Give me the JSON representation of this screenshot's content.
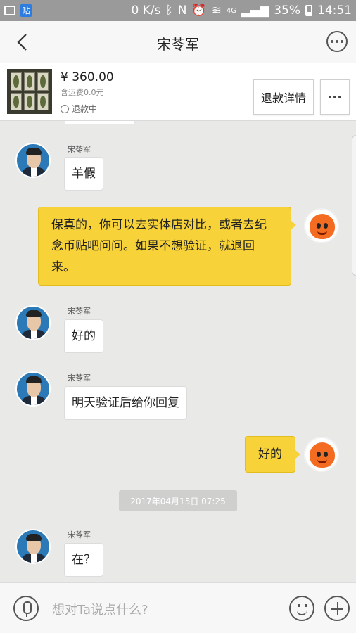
{
  "status_bar": {
    "speed": "0 K/s",
    "network": "4G",
    "battery": "35%",
    "time": "14:51",
    "app_icon": "贴"
  },
  "nav": {
    "title": "宋苓军"
  },
  "product": {
    "price": "¥ 360.00",
    "shipping": "含运费0.0元",
    "status": "退款中",
    "refund_button": "退款详情"
  },
  "messages": [
    {
      "side": "left",
      "name": "宋苓军",
      "text": "羊假"
    },
    {
      "side": "right",
      "text": "保真的，你可以去实体店对比，或者去纪念币贴吧问问。如果不想验证，就退回来。"
    },
    {
      "side": "left",
      "name": "宋苓军",
      "text": "好的"
    },
    {
      "side": "left",
      "name": "宋苓军",
      "text": "明天验证后给你回复"
    },
    {
      "side": "right",
      "text": "好的"
    },
    {
      "side": "left",
      "name": "宋苓军",
      "text": "在？"
    }
  ],
  "timestamp": "2017年04月15日 07:25",
  "input": {
    "placeholder": "想对Ta说点什么?"
  }
}
